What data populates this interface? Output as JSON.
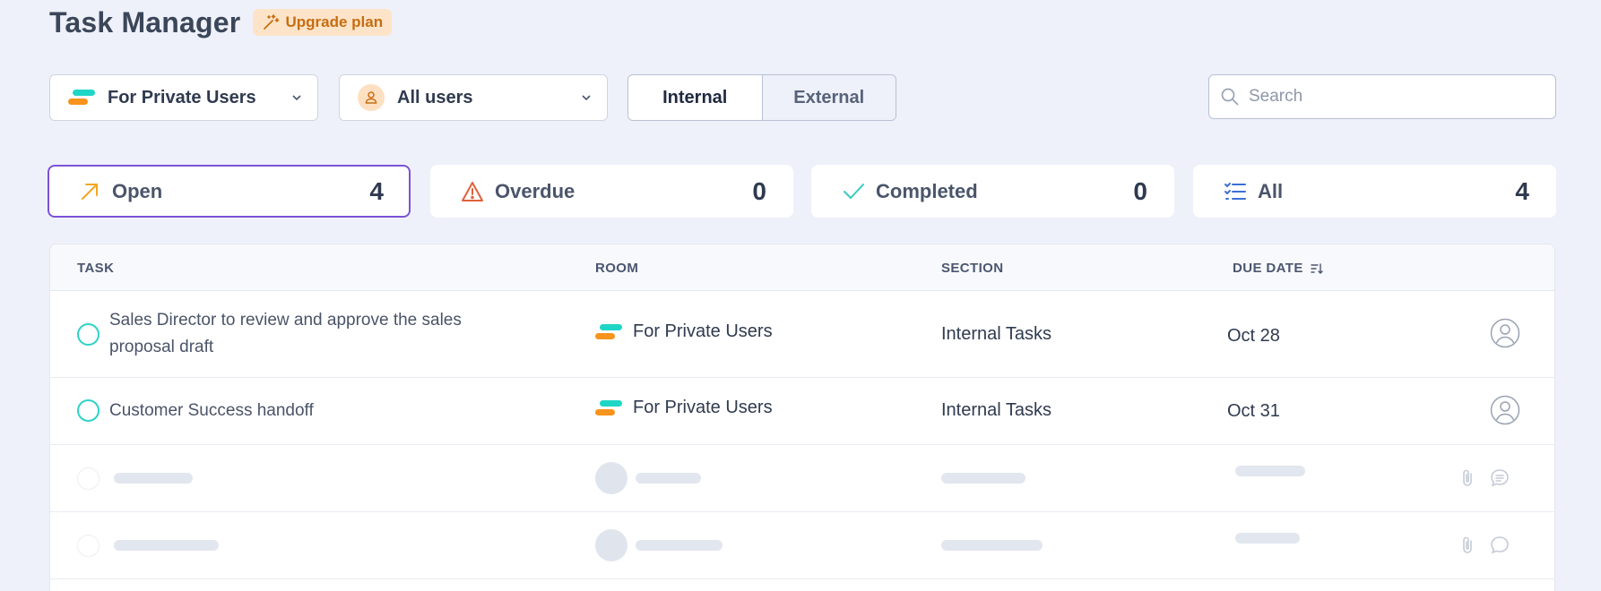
{
  "header": {
    "title": "Task Manager",
    "upgrade_label": "Upgrade plan"
  },
  "filters": {
    "room_dropdown": "For Private Users",
    "user_dropdown": "All users",
    "segment": {
      "internal": "Internal",
      "external": "External",
      "selected": "Internal"
    },
    "search": {
      "placeholder": "Search",
      "value": ""
    }
  },
  "stats": [
    {
      "name": "Open",
      "count": "4",
      "icon": "arrow-up-right-icon",
      "color": "#f5a623"
    },
    {
      "name": "Overdue",
      "count": "0",
      "icon": "warning-icon",
      "color": "#e2603a"
    },
    {
      "name": "Completed",
      "count": "0",
      "icon": "check-icon",
      "color": "#35cdbf"
    },
    {
      "name": "All",
      "count": "4",
      "icon": "list-check-icon",
      "color": "#3b6fd4"
    }
  ],
  "table": {
    "columns": {
      "task": "TASK",
      "room": "ROOM",
      "section": "SECTION",
      "due_date": "DUE DATE"
    },
    "rows": [
      {
        "task_line1": "Sales Director to review and approve the sales",
        "task_line2": "proposal draft",
        "room": "For Private Users",
        "section": "Internal Tasks",
        "due_date": "Oct 28"
      },
      {
        "task": "Customer Success handoff",
        "room": "For Private Users",
        "section": "Internal Tasks",
        "due_date": "Oct 31"
      }
    ]
  },
  "colors": {
    "accent_selected": "#7c52d8",
    "task_circle": "#2ed3c6",
    "upgrade_bg": "#fde4c8",
    "upgrade_text": "#c86d12"
  }
}
